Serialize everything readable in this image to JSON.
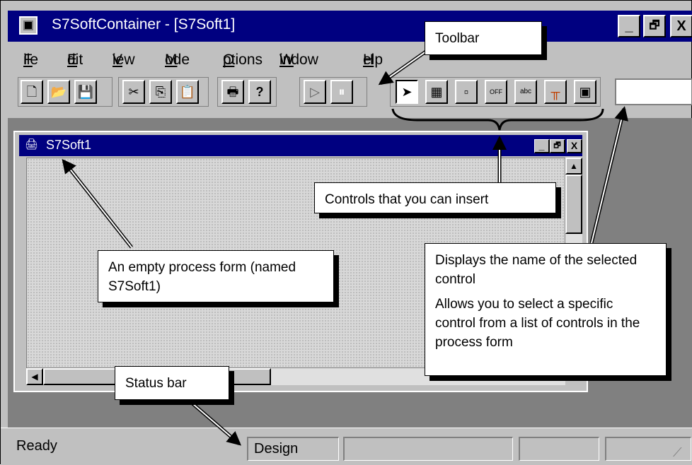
{
  "window": {
    "title": "S7SoftContainer - [S7Soft1]",
    "minimize": "_",
    "restore": "🗗",
    "close": "X"
  },
  "menu": [
    {
      "label": "File",
      "accel": "F",
      "rest": "ile"
    },
    {
      "label": "Edit",
      "accel": "E",
      "rest": "dit"
    },
    {
      "label": "View",
      "accel": "V",
      "rest": "iew"
    },
    {
      "label": "Mode",
      "accel": "M",
      "rest": "ode"
    },
    {
      "label": "Options",
      "accel": "O",
      "rest": "ptions"
    },
    {
      "label": "Window",
      "accel": "W",
      "rest": "indow"
    },
    {
      "label": "Help",
      "accel": "H",
      "rest": "elp"
    }
  ],
  "toolbar": {
    "buttons": [
      {
        "name": "new-file-icon",
        "glyph": "🗋"
      },
      {
        "name": "open-folder-icon",
        "glyph": "📂"
      },
      {
        "name": "save-icon",
        "glyph": "💾"
      },
      {
        "name": "cut-icon",
        "glyph": "✂"
      },
      {
        "name": "copy-icon",
        "glyph": "⎘"
      },
      {
        "name": "paste-icon",
        "glyph": "📋"
      },
      {
        "name": "print-icon",
        "glyph": "🖶"
      },
      {
        "name": "help-icon",
        "glyph": "?"
      },
      {
        "name": "run-icon",
        "glyph": "▷"
      },
      {
        "name": "pause-icon",
        "glyph": "⏸"
      }
    ],
    "controls": [
      {
        "name": "pointer-icon",
        "glyph": "➤"
      },
      {
        "name": "control-a-icon",
        "glyph": "▦"
      },
      {
        "name": "control-b-icon",
        "glyph": "▫"
      },
      {
        "name": "off-switch-icon",
        "glyph": "OFF"
      },
      {
        "name": "text-control-icon",
        "glyph": "abc"
      },
      {
        "name": "slider-control-icon",
        "glyph": "╥"
      },
      {
        "name": "control-c-icon",
        "glyph": "▣"
      }
    ]
  },
  "child_window": {
    "title": "S7Soft1"
  },
  "status": {
    "ready": "Ready",
    "mode": "Design"
  },
  "callouts": {
    "toolbar": "Toolbar",
    "controls": "Controls that you can insert",
    "empty_form": "An empty process form (named S7Soft1)",
    "name_display_1": "Displays the name of the selected control",
    "name_display_2": "Allows you to select a specific control from a list of controls in the process form",
    "status_bar": "Status bar"
  }
}
